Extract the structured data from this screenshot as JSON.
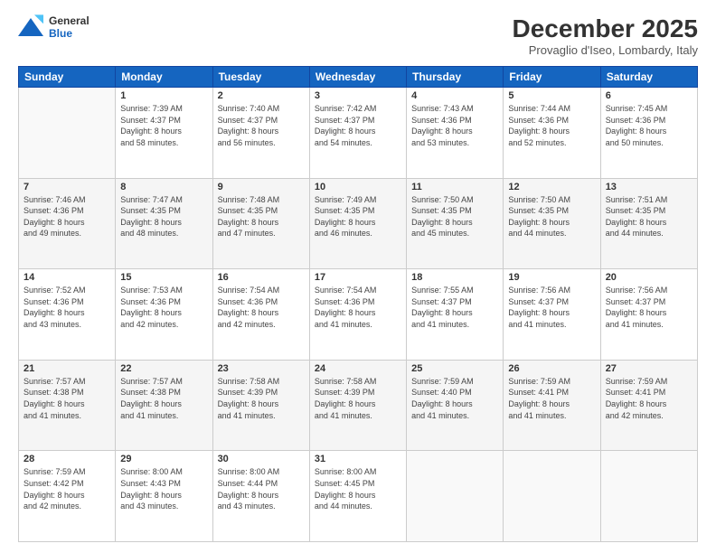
{
  "header": {
    "logo_line1": "General",
    "logo_line2": "Blue",
    "title": "December 2025",
    "subtitle": "Provaglio d'Iseo, Lombardy, Italy"
  },
  "days_of_week": [
    "Sunday",
    "Monday",
    "Tuesday",
    "Wednesday",
    "Thursday",
    "Friday",
    "Saturday"
  ],
  "weeks": [
    [
      {
        "day": "",
        "info": ""
      },
      {
        "day": "1",
        "info": "Sunrise: 7:39 AM\nSunset: 4:37 PM\nDaylight: 8 hours\nand 58 minutes."
      },
      {
        "day": "2",
        "info": "Sunrise: 7:40 AM\nSunset: 4:37 PM\nDaylight: 8 hours\nand 56 minutes."
      },
      {
        "day": "3",
        "info": "Sunrise: 7:42 AM\nSunset: 4:37 PM\nDaylight: 8 hours\nand 54 minutes."
      },
      {
        "day": "4",
        "info": "Sunrise: 7:43 AM\nSunset: 4:36 PM\nDaylight: 8 hours\nand 53 minutes."
      },
      {
        "day": "5",
        "info": "Sunrise: 7:44 AM\nSunset: 4:36 PM\nDaylight: 8 hours\nand 52 minutes."
      },
      {
        "day": "6",
        "info": "Sunrise: 7:45 AM\nSunset: 4:36 PM\nDaylight: 8 hours\nand 50 minutes."
      }
    ],
    [
      {
        "day": "7",
        "info": "Sunrise: 7:46 AM\nSunset: 4:36 PM\nDaylight: 8 hours\nand 49 minutes."
      },
      {
        "day": "8",
        "info": "Sunrise: 7:47 AM\nSunset: 4:35 PM\nDaylight: 8 hours\nand 48 minutes."
      },
      {
        "day": "9",
        "info": "Sunrise: 7:48 AM\nSunset: 4:35 PM\nDaylight: 8 hours\nand 47 minutes."
      },
      {
        "day": "10",
        "info": "Sunrise: 7:49 AM\nSunset: 4:35 PM\nDaylight: 8 hours\nand 46 minutes."
      },
      {
        "day": "11",
        "info": "Sunrise: 7:50 AM\nSunset: 4:35 PM\nDaylight: 8 hours\nand 45 minutes."
      },
      {
        "day": "12",
        "info": "Sunrise: 7:50 AM\nSunset: 4:35 PM\nDaylight: 8 hours\nand 44 minutes."
      },
      {
        "day": "13",
        "info": "Sunrise: 7:51 AM\nSunset: 4:35 PM\nDaylight: 8 hours\nand 44 minutes."
      }
    ],
    [
      {
        "day": "14",
        "info": "Sunrise: 7:52 AM\nSunset: 4:36 PM\nDaylight: 8 hours\nand 43 minutes."
      },
      {
        "day": "15",
        "info": "Sunrise: 7:53 AM\nSunset: 4:36 PM\nDaylight: 8 hours\nand 42 minutes."
      },
      {
        "day": "16",
        "info": "Sunrise: 7:54 AM\nSunset: 4:36 PM\nDaylight: 8 hours\nand 42 minutes."
      },
      {
        "day": "17",
        "info": "Sunrise: 7:54 AM\nSunset: 4:36 PM\nDaylight: 8 hours\nand 41 minutes."
      },
      {
        "day": "18",
        "info": "Sunrise: 7:55 AM\nSunset: 4:37 PM\nDaylight: 8 hours\nand 41 minutes."
      },
      {
        "day": "19",
        "info": "Sunrise: 7:56 AM\nSunset: 4:37 PM\nDaylight: 8 hours\nand 41 minutes."
      },
      {
        "day": "20",
        "info": "Sunrise: 7:56 AM\nSunset: 4:37 PM\nDaylight: 8 hours\nand 41 minutes."
      }
    ],
    [
      {
        "day": "21",
        "info": "Sunrise: 7:57 AM\nSunset: 4:38 PM\nDaylight: 8 hours\nand 41 minutes."
      },
      {
        "day": "22",
        "info": "Sunrise: 7:57 AM\nSunset: 4:38 PM\nDaylight: 8 hours\nand 41 minutes."
      },
      {
        "day": "23",
        "info": "Sunrise: 7:58 AM\nSunset: 4:39 PM\nDaylight: 8 hours\nand 41 minutes."
      },
      {
        "day": "24",
        "info": "Sunrise: 7:58 AM\nSunset: 4:39 PM\nDaylight: 8 hours\nand 41 minutes."
      },
      {
        "day": "25",
        "info": "Sunrise: 7:59 AM\nSunset: 4:40 PM\nDaylight: 8 hours\nand 41 minutes."
      },
      {
        "day": "26",
        "info": "Sunrise: 7:59 AM\nSunset: 4:41 PM\nDaylight: 8 hours\nand 41 minutes."
      },
      {
        "day": "27",
        "info": "Sunrise: 7:59 AM\nSunset: 4:41 PM\nDaylight: 8 hours\nand 42 minutes."
      }
    ],
    [
      {
        "day": "28",
        "info": "Sunrise: 7:59 AM\nSunset: 4:42 PM\nDaylight: 8 hours\nand 42 minutes."
      },
      {
        "day": "29",
        "info": "Sunrise: 8:00 AM\nSunset: 4:43 PM\nDaylight: 8 hours\nand 43 minutes."
      },
      {
        "day": "30",
        "info": "Sunrise: 8:00 AM\nSunset: 4:44 PM\nDaylight: 8 hours\nand 43 minutes."
      },
      {
        "day": "31",
        "info": "Sunrise: 8:00 AM\nSunset: 4:45 PM\nDaylight: 8 hours\nand 44 minutes."
      },
      {
        "day": "",
        "info": ""
      },
      {
        "day": "",
        "info": ""
      },
      {
        "day": "",
        "info": ""
      }
    ]
  ]
}
